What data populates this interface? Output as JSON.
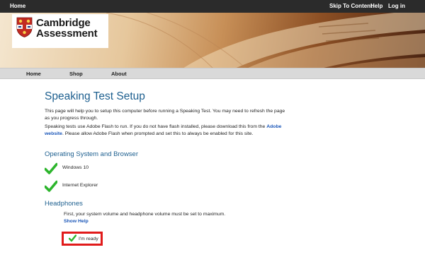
{
  "topbar": {
    "home": "Home",
    "skip": "Skip To Content",
    "help": "Help",
    "login": "Log in"
  },
  "logo": {
    "line1": "Cambridge",
    "line2": "Assessment"
  },
  "nav": {
    "home": "Home",
    "shop": "Shop",
    "about": "About"
  },
  "page": {
    "title": "Speaking Test Setup",
    "intro": "This page will help you to setup this computer before running a Speaking Test. You may need to refresh the page as you progress through.",
    "flash_before": "Speaking tests use Adobe Flash to run. If you do not have flash installed, please download this from the ",
    "flash_link": "Adobe website",
    "flash_after": ". Please allow Adobe Flash when prompted and set this to always be enabled for this site."
  },
  "os_section": {
    "heading": "Operating System and Browser",
    "items": [
      "Windows 10",
      "Internet Explorer"
    ]
  },
  "headphones": {
    "heading": "Headphones",
    "text": "First, your system volume and headphone volume must be set to maximum.",
    "help_link": "Show Help",
    "ready_label": "I'm ready"
  },
  "colors": {
    "heading": "#1d5f8f",
    "link": "#1a56b8",
    "check": "#2db52d",
    "highlight": "#e11b1b",
    "topbar": "#2b2b2b",
    "navbar": "#d9d9d9"
  }
}
